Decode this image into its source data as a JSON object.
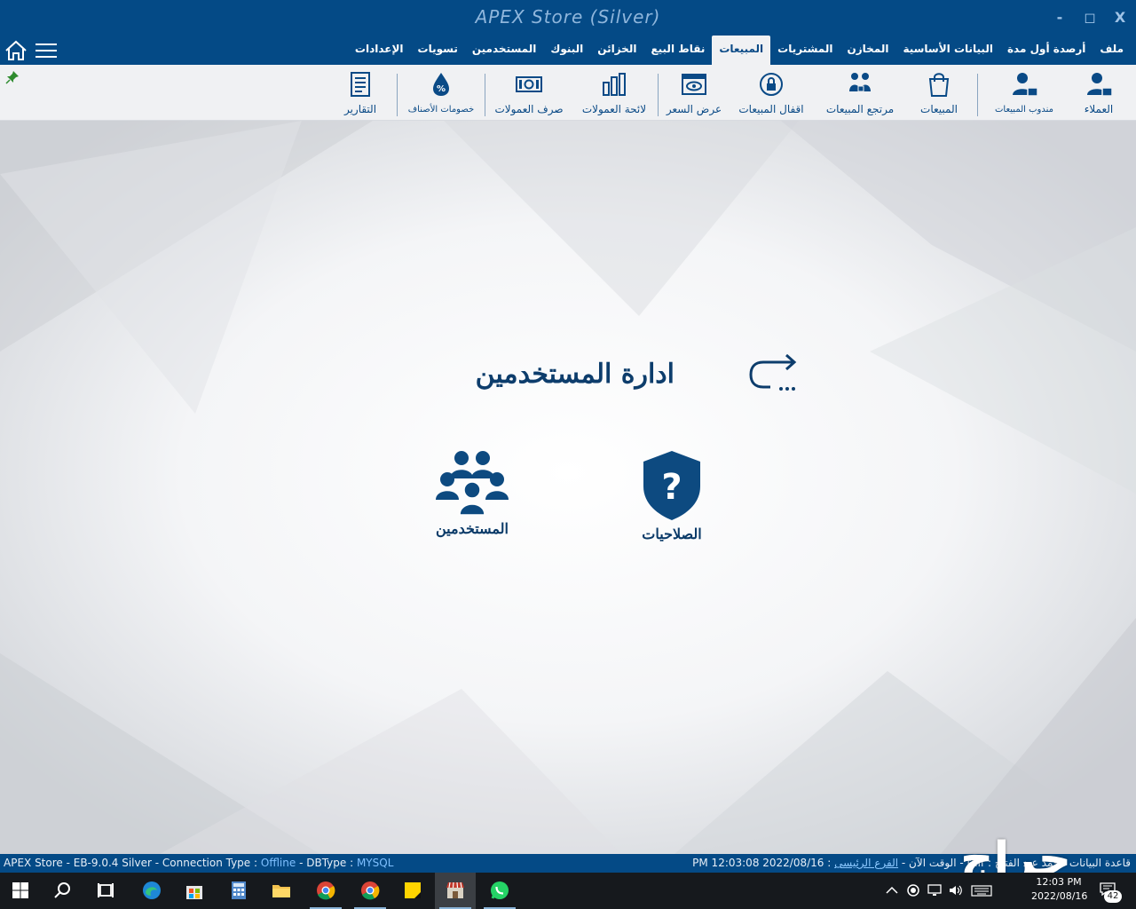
{
  "titlebar": {
    "title": "APEX Store (Silver)",
    "minimize": "-",
    "maximize": "◻",
    "close": "X"
  },
  "menu": {
    "tabs": [
      {
        "label": "ملف"
      },
      {
        "label": "أرصدة أول مدة"
      },
      {
        "label": "البيانات الأساسية"
      },
      {
        "label": "المخازن"
      },
      {
        "label": "المشتريات"
      },
      {
        "label": "المبيعات",
        "active": true
      },
      {
        "label": "نقاط البيع"
      },
      {
        "label": "الخزائن"
      },
      {
        "label": "البنوك"
      },
      {
        "label": "المستخدمين"
      },
      {
        "label": "تسويات"
      },
      {
        "label": "الإعدادات"
      }
    ]
  },
  "ribbon": {
    "customers": "العملاء",
    "sales_rep": "مندوب المبيعات",
    "sales": "المبيعات",
    "sales_returns": "مرتجع المبيعات",
    "sales_lock": "اقفال المبيعات",
    "price_quote": "عرض السعر",
    "commission_list": "لائحة العمولات",
    "commission_payout": "صرف العمولات",
    "item_discounts": "خصومات الأصناف",
    "reports": "التقارير"
  },
  "main": {
    "title": "ادارة المستخدمين",
    "tiles": {
      "permissions": "الصلاحيات",
      "users": "المستخدمين"
    }
  },
  "status": {
    "app": "APEX Store - EB-9.0.4 Silver",
    "sep": " - ",
    "connection_label": "Connection Type :",
    "connection_value": "Offline",
    "dbtype_label": "DBType :",
    "dbtype_value": "MYSQL",
    "time_value": "PM 12:03:08 2022/08/16",
    "time_label": ": الوقت الآن",
    "branch": "الفرع الرئيسى",
    "city": "taif",
    "db": ": قاعدة البيانات",
    "user": "محمد عبد الفتاح"
  },
  "watermark": "حراج",
  "taskbar": {
    "time": "12:03 PM",
    "date": "2022/08/16",
    "notifications": "42"
  },
  "colors": {
    "primary": "#044a86",
    "accent_text": "#0a4a86",
    "statusbar": "#044a86",
    "taskbar": "#16191d"
  }
}
